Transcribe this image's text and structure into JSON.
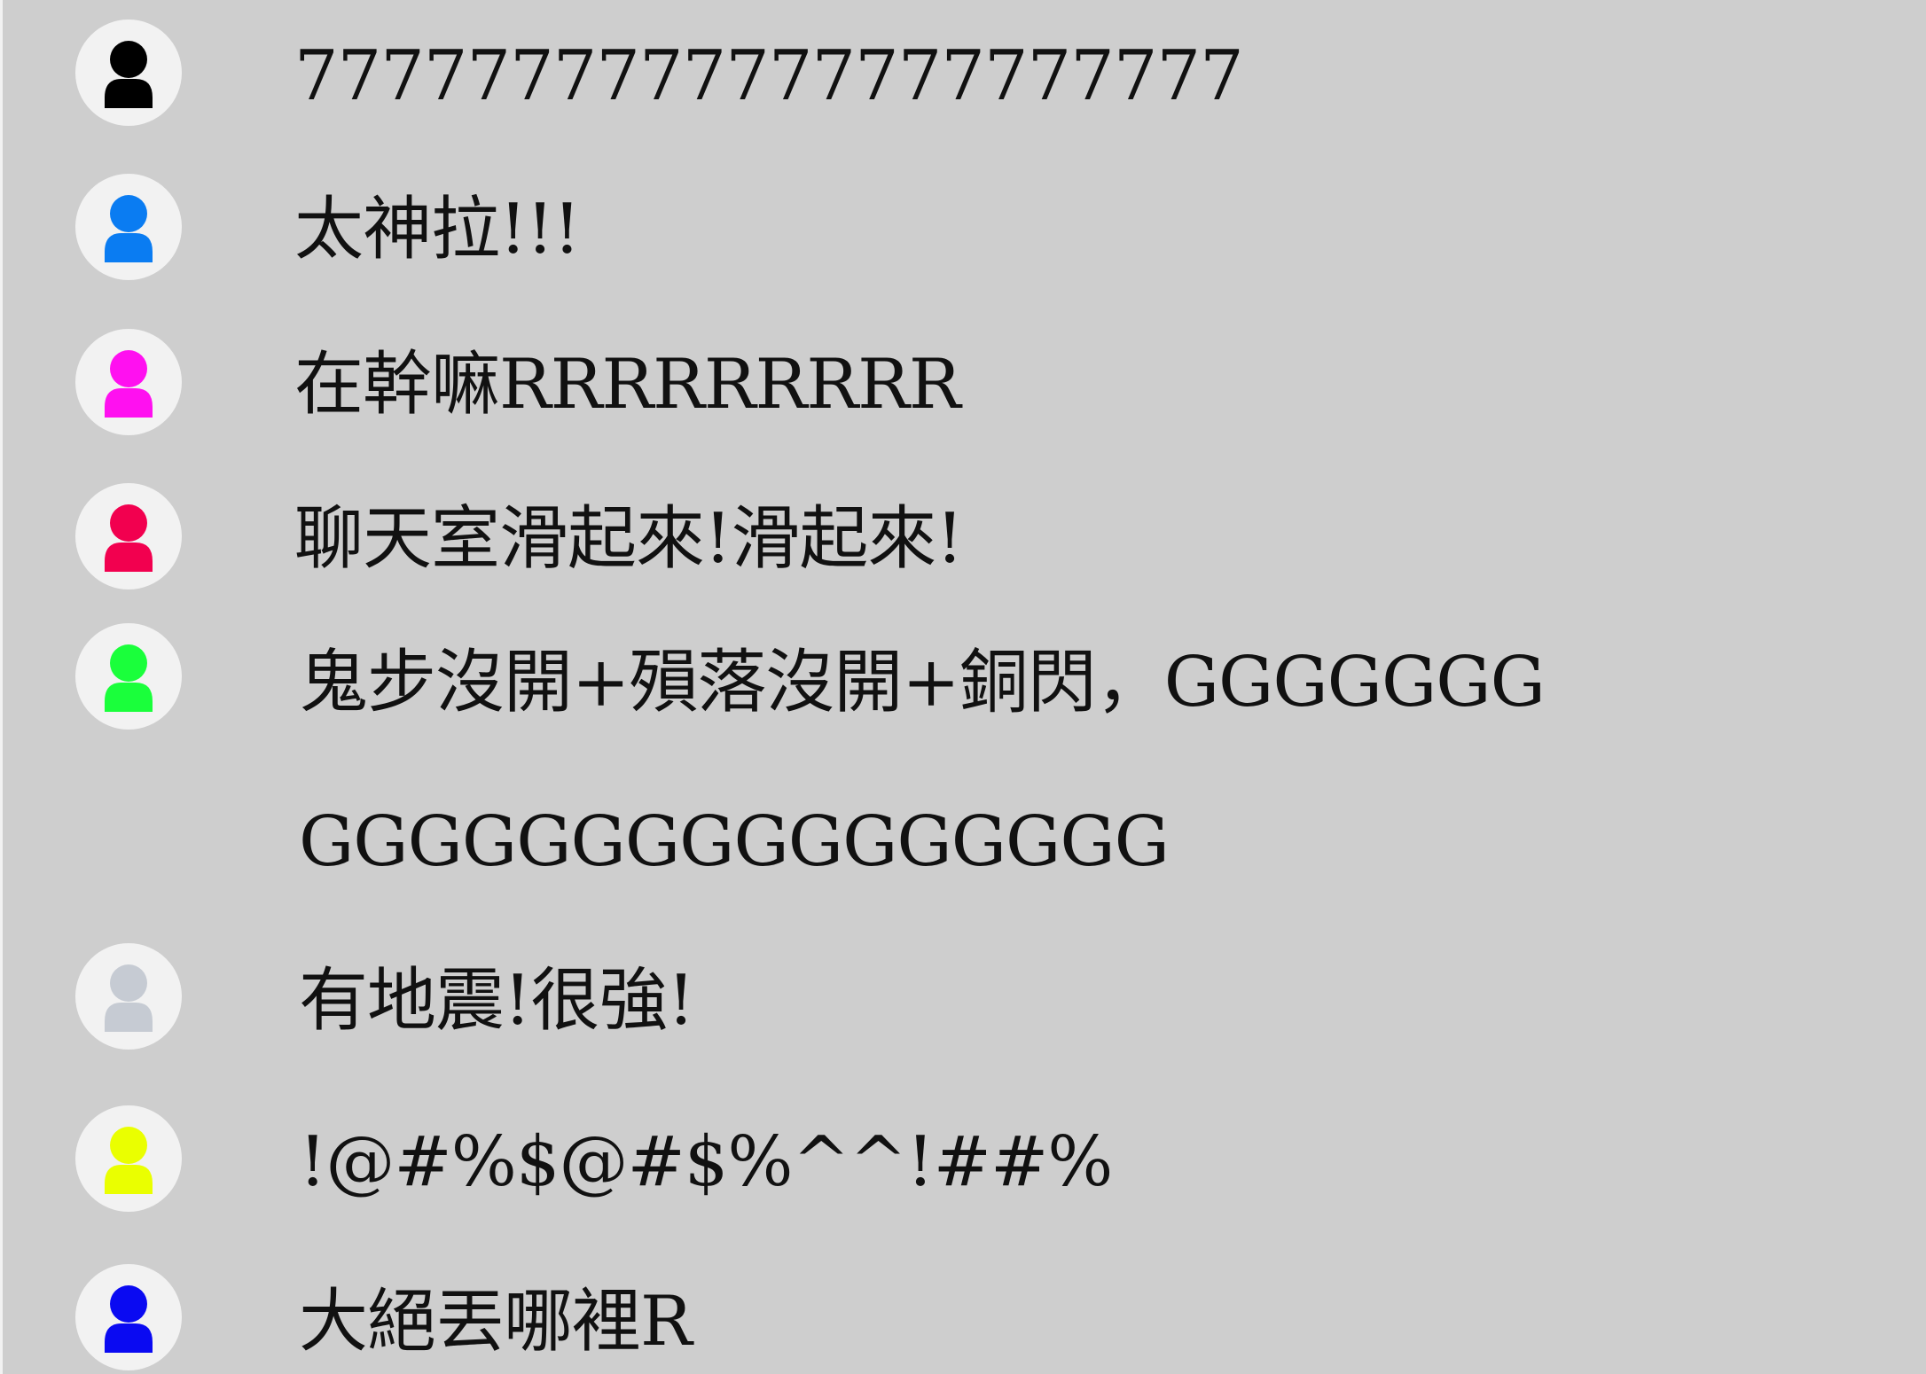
{
  "chat": {
    "messages": [
      {
        "avatar_icon": "user-icon",
        "avatar_color": "#000000",
        "text": "7777777777777777777777"
      },
      {
        "avatar_icon": "user-icon",
        "avatar_color": "#0a7cf2",
        "text": "太神拉!!!"
      },
      {
        "avatar_icon": "user-icon",
        "avatar_color": "#ff10f0",
        "text": "在幹嘛RRRRRRRRR"
      },
      {
        "avatar_icon": "user-icon",
        "avatar_color": "#f2004f",
        "text": "聊天室滑起來!滑起來!"
      },
      {
        "avatar_icon": "user-icon",
        "avatar_color": "#1aff3b",
        "text": "鬼步沒開+殞落沒開+銅閃，GGGGGGGGGGGGGGGGGGGGGGG"
      },
      {
        "avatar_icon": "user-icon",
        "avatar_color": "#c6cbd3",
        "text": "有地震!很強!"
      },
      {
        "avatar_icon": "user-icon",
        "avatar_color": "#eaff00",
        "text": "!@#%$@#$%^^!##%"
      },
      {
        "avatar_icon": "user-icon",
        "avatar_color": "#0a0af2",
        "text": "大絕丟哪裡R"
      }
    ]
  }
}
